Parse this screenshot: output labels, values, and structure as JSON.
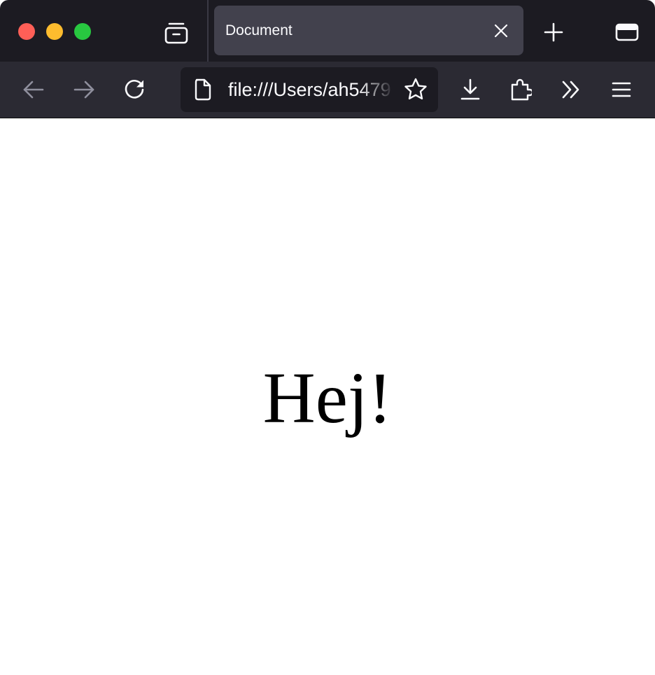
{
  "browser": {
    "tab": {
      "title": "Document"
    },
    "address_bar": {
      "url": "file:///Users/ah5479"
    },
    "icons": {
      "firefox_view": "firefox-view-icon",
      "close_tab": "close-icon",
      "new_tab": "plus-icon",
      "tab_list": "tab-list-icon",
      "back": "arrow-left-icon",
      "forward": "arrow-right-icon",
      "reload": "reload-icon",
      "page": "page-icon",
      "bookmark": "star-icon",
      "downloads": "download-icon",
      "extensions": "puzzle-icon",
      "overflow": "chevron-double-right-icon",
      "menu": "hamburger-menu-icon"
    },
    "colors": {
      "tabstrip_bg": "#1c1b22",
      "selected_tab_bg": "#42414d",
      "toolbar_bg": "#2b2a33",
      "traffic_close": "#ff5f57",
      "traffic_minimize": "#febc2e",
      "traffic_maximize": "#28c840"
    }
  },
  "page": {
    "heading": "Hej!"
  }
}
